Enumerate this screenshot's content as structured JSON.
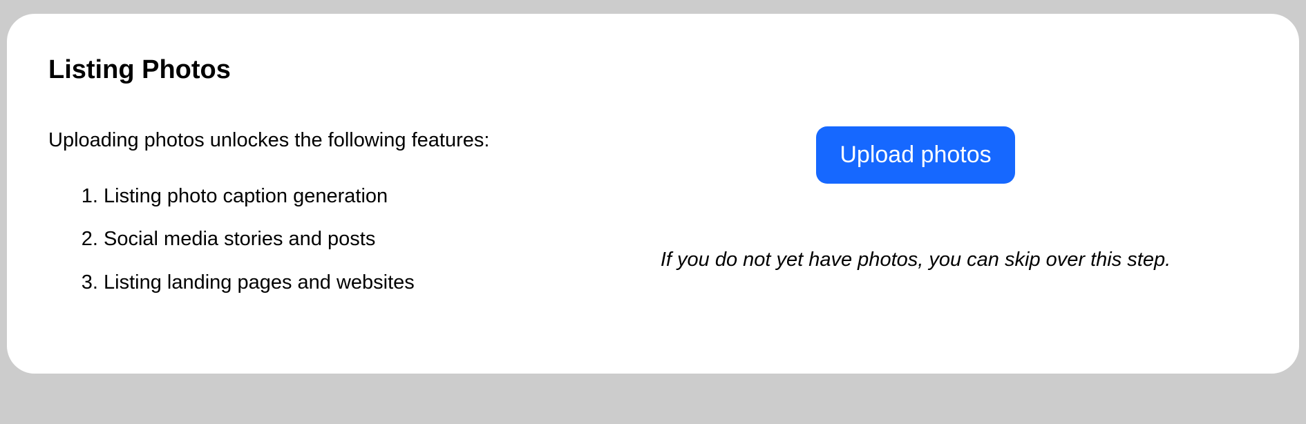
{
  "card": {
    "title": "Listing Photos",
    "intro": "Uploading photos unlockes the following features:",
    "features": [
      "Listing photo caption generation",
      "Social media stories and posts",
      "Listing landing pages and websites"
    ],
    "upload_button_label": "Upload photos",
    "skip_text": "If you do not yet have photos, you can skip over this step."
  }
}
